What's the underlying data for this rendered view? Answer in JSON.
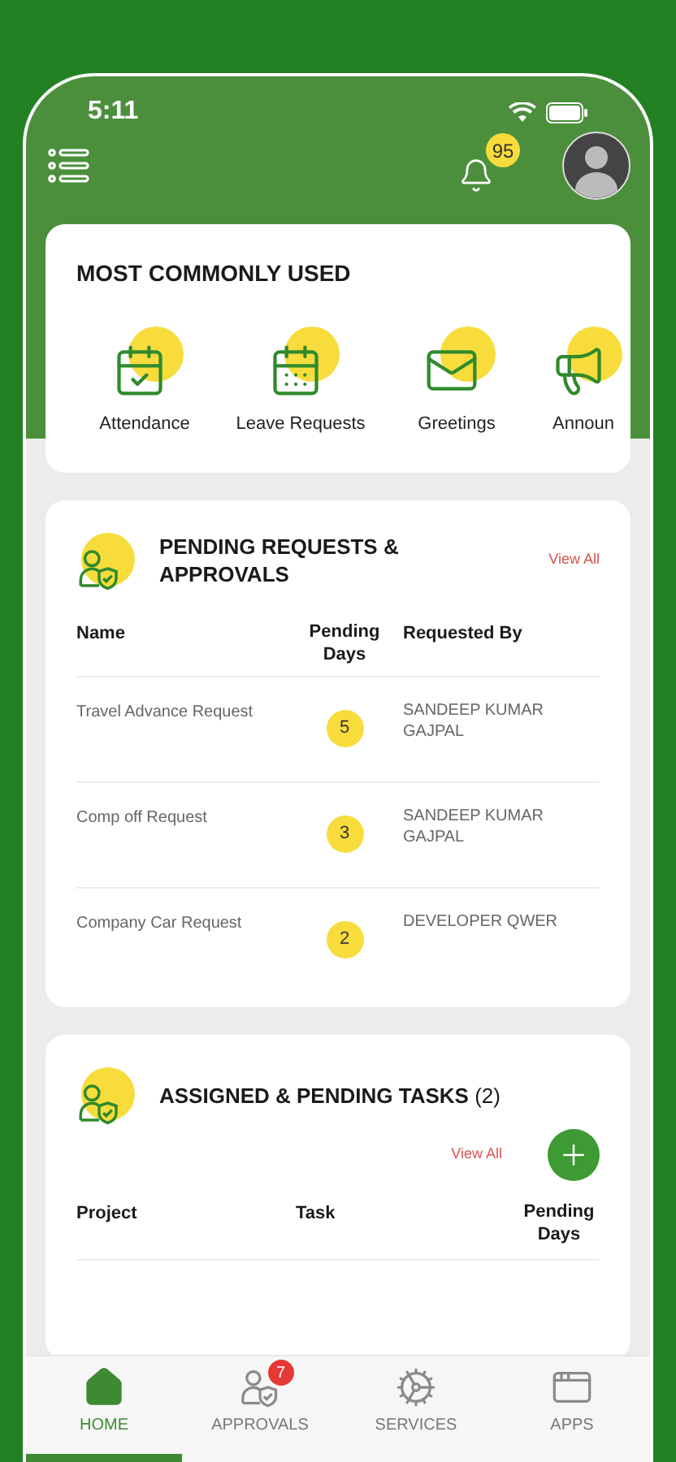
{
  "status_bar": {
    "time": "5:11"
  },
  "header": {
    "notification_count": "95"
  },
  "most_used": {
    "title": "MOST COMMONLY USED",
    "items": [
      {
        "kind": "attendance",
        "label": "Attendance"
      },
      {
        "kind": "leave",
        "label": "Leave Requests"
      },
      {
        "kind": "greetings",
        "label": "Greetings"
      },
      {
        "kind": "announcements",
        "label": "Announ"
      }
    ]
  },
  "pending_requests": {
    "title": "PENDING REQUESTS & APPROVALS",
    "view_all": "View All",
    "columns": [
      "Name",
      "Pending Days",
      "Requested By"
    ],
    "rows": [
      {
        "name": "Travel Advance Request",
        "days": "5",
        "requested_by": "SANDEEP KUMAR GAJPAL"
      },
      {
        "name": "Comp off Request",
        "days": "3",
        "requested_by": "SANDEEP KUMAR GAJPAL"
      },
      {
        "name": "Company Car Request",
        "days": "2",
        "requested_by": "DEVELOPER QWER"
      }
    ]
  },
  "tasks": {
    "title": "ASSIGNED & PENDING TASKS",
    "count": "(2)",
    "view_all": "View All",
    "columns": [
      "Project",
      "Task",
      "Pending Days"
    ]
  },
  "tab_bar": {
    "items": [
      {
        "kind": "home",
        "label": "HOME",
        "selected": true
      },
      {
        "kind": "approvals",
        "label": "APPROVALS",
        "selected": false,
        "badge": "7"
      },
      {
        "kind": "services",
        "label": "SERVICES",
        "selected": false
      },
      {
        "kind": "apps",
        "label": "APPS",
        "selected": false
      }
    ]
  }
}
